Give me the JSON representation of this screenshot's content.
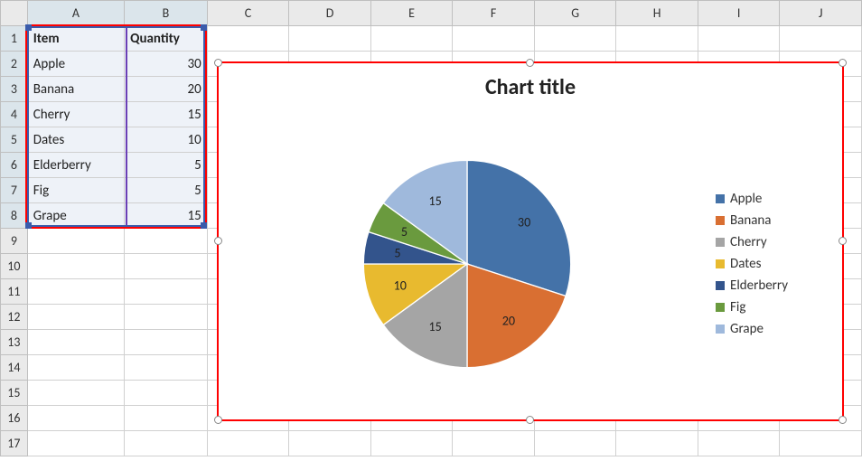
{
  "columns": [
    "A",
    "B",
    "C",
    "D",
    "E",
    "F",
    "G",
    "H",
    "I",
    "J"
  ],
  "row_count": 17,
  "col_widths": {
    "row_header": 30,
    "A": 108,
    "B": 92,
    "other": 92
  },
  "table": {
    "headers": [
      "Item",
      "Quantity"
    ],
    "rows": [
      {
        "item": "Apple",
        "qty": "30"
      },
      {
        "item": "Banana",
        "qty": "20"
      },
      {
        "item": "Cherry",
        "qty": "15"
      },
      {
        "item": "Dates",
        "qty": "10"
      },
      {
        "item": "Elderberry",
        "qty": "5"
      },
      {
        "item": "Fig",
        "qty": "5"
      },
      {
        "item": "Grape",
        "qty": "15"
      }
    ]
  },
  "chart": {
    "title": "Chart title",
    "colors": {
      "Apple": "#4472A8",
      "Banana": "#D96F32",
      "Cherry": "#A5A5A5",
      "Dates": "#E8BA2F",
      "Elderberry": "#33548C",
      "Fig": "#6A9A3E",
      "Grape": "#9FB9DC"
    }
  },
  "chart_data": {
    "type": "pie",
    "title": "Chart title",
    "categories": [
      "Apple",
      "Banana",
      "Cherry",
      "Dates",
      "Elderberry",
      "Fig",
      "Grape"
    ],
    "values": [
      30,
      20,
      15,
      10,
      5,
      5,
      15
    ],
    "data_labels": [
      "30",
      "20",
      "15",
      "10",
      "5",
      "5",
      "15"
    ],
    "legend_position": "right"
  }
}
